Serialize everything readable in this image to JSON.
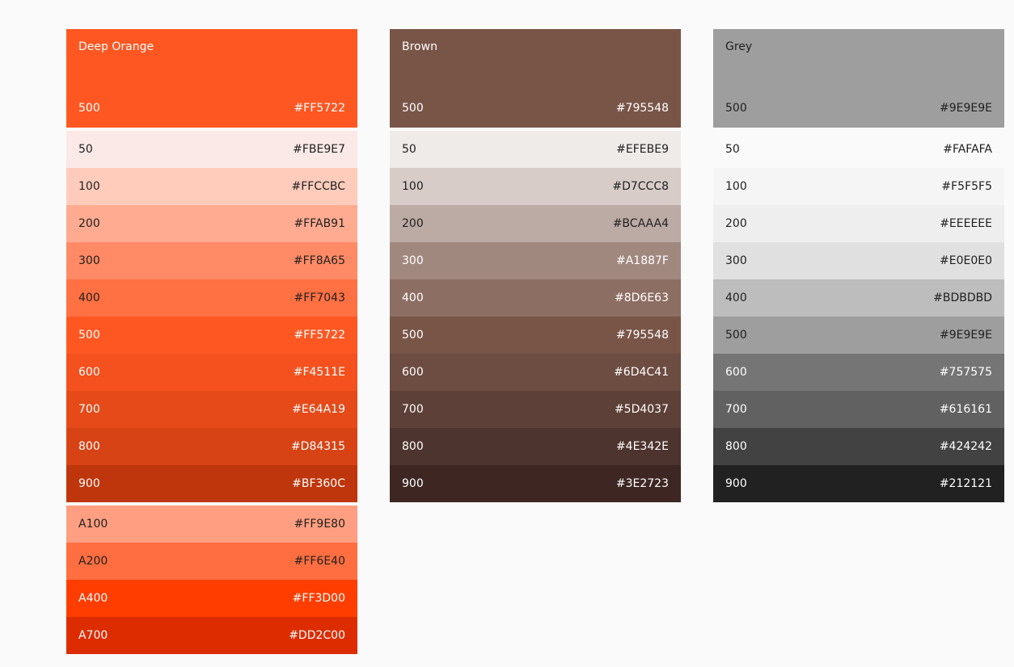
{
  "palettes": [
    {
      "name": "Deep Orange",
      "primary": {
        "shade": "500",
        "hex": "#FF5722",
        "bg": "#FF5722",
        "fg": "#ffffff"
      },
      "shades": [
        {
          "shade": "50",
          "hex": "#FBE9E7",
          "bg": "#FBE9E7",
          "fg": "#212121"
        },
        {
          "shade": "100",
          "hex": "#FFCCBC",
          "bg": "#FFCCBC",
          "fg": "#212121"
        },
        {
          "shade": "200",
          "hex": "#FFAB91",
          "bg": "#FFAB91",
          "fg": "#212121"
        },
        {
          "shade": "300",
          "hex": "#FF8A65",
          "bg": "#FF8A65",
          "fg": "#212121"
        },
        {
          "shade": "400",
          "hex": "#FF7043",
          "bg": "#FF7043",
          "fg": "#212121"
        },
        {
          "shade": "500",
          "hex": "#FF5722",
          "bg": "#FF5722",
          "fg": "#ffffff"
        },
        {
          "shade": "600",
          "hex": "#F4511E",
          "bg": "#F4511E",
          "fg": "#ffffff"
        },
        {
          "shade": "700",
          "hex": "#E64A19",
          "bg": "#E64A19",
          "fg": "#ffffff"
        },
        {
          "shade": "800",
          "hex": "#D84315",
          "bg": "#D84315",
          "fg": "#ffffff"
        },
        {
          "shade": "900",
          "hex": "#BF360C",
          "bg": "#BF360C",
          "fg": "#ffffff"
        }
      ],
      "accents": [
        {
          "shade": "A100",
          "hex": "#FF9E80",
          "bg": "#FF9E80",
          "fg": "#212121"
        },
        {
          "shade": "A200",
          "hex": "#FF6E40",
          "bg": "#FF6E40",
          "fg": "#212121"
        },
        {
          "shade": "A400",
          "hex": "#FF3D00",
          "bg": "#FF3D00",
          "fg": "#ffffff"
        },
        {
          "shade": "A700",
          "hex": "#DD2C00",
          "bg": "#DD2C00",
          "fg": "#ffffff"
        }
      ]
    },
    {
      "name": "Brown",
      "primary": {
        "shade": "500",
        "hex": "#795548",
        "bg": "#795548",
        "fg": "#ffffff"
      },
      "shades": [
        {
          "shade": "50",
          "hex": "#EFEBE9",
          "bg": "#EFEBE9",
          "fg": "#212121"
        },
        {
          "shade": "100",
          "hex": "#D7CCC8",
          "bg": "#D7CCC8",
          "fg": "#212121"
        },
        {
          "shade": "200",
          "hex": "#BCAAA4",
          "bg": "#BCAAA4",
          "fg": "#212121"
        },
        {
          "shade": "300",
          "hex": "#A1887F",
          "bg": "#A1887F",
          "fg": "#ffffff"
        },
        {
          "shade": "400",
          "hex": "#8D6E63",
          "bg": "#8D6E63",
          "fg": "#ffffff"
        },
        {
          "shade": "500",
          "hex": "#795548",
          "bg": "#795548",
          "fg": "#ffffff"
        },
        {
          "shade": "600",
          "hex": "#6D4C41",
          "bg": "#6D4C41",
          "fg": "#ffffff"
        },
        {
          "shade": "700",
          "hex": "#5D4037",
          "bg": "#5D4037",
          "fg": "#ffffff"
        },
        {
          "shade": "800",
          "hex": "#4E342E",
          "bg": "#4E342E",
          "fg": "#ffffff"
        },
        {
          "shade": "900",
          "hex": "#3E2723",
          "bg": "#3E2723",
          "fg": "#ffffff"
        }
      ],
      "accents": []
    },
    {
      "name": "Grey",
      "primary": {
        "shade": "500",
        "hex": "#9E9E9E",
        "bg": "#9E9E9E",
        "fg": "#212121"
      },
      "shades": [
        {
          "shade": "50",
          "hex": "#FAFAFA",
          "bg": "#FAFAFA",
          "fg": "#212121"
        },
        {
          "shade": "100",
          "hex": "#F5F5F5",
          "bg": "#F5F5F5",
          "fg": "#212121"
        },
        {
          "shade": "200",
          "hex": "#EEEEEE",
          "bg": "#EEEEEE",
          "fg": "#212121"
        },
        {
          "shade": "300",
          "hex": "#E0E0E0",
          "bg": "#E0E0E0",
          "fg": "#212121"
        },
        {
          "shade": "400",
          "hex": "#BDBDBD",
          "bg": "#BDBDBD",
          "fg": "#212121"
        },
        {
          "shade": "500",
          "hex": "#9E9E9E",
          "bg": "#9E9E9E",
          "fg": "#212121"
        },
        {
          "shade": "600",
          "hex": "#757575",
          "bg": "#757575",
          "fg": "#ffffff"
        },
        {
          "shade": "700",
          "hex": "#616161",
          "bg": "#616161",
          "fg": "#ffffff"
        },
        {
          "shade": "800",
          "hex": "#424242",
          "bg": "#424242",
          "fg": "#ffffff"
        },
        {
          "shade": "900",
          "hex": "#212121",
          "bg": "#212121",
          "fg": "#ffffff"
        }
      ],
      "accents": []
    }
  ]
}
